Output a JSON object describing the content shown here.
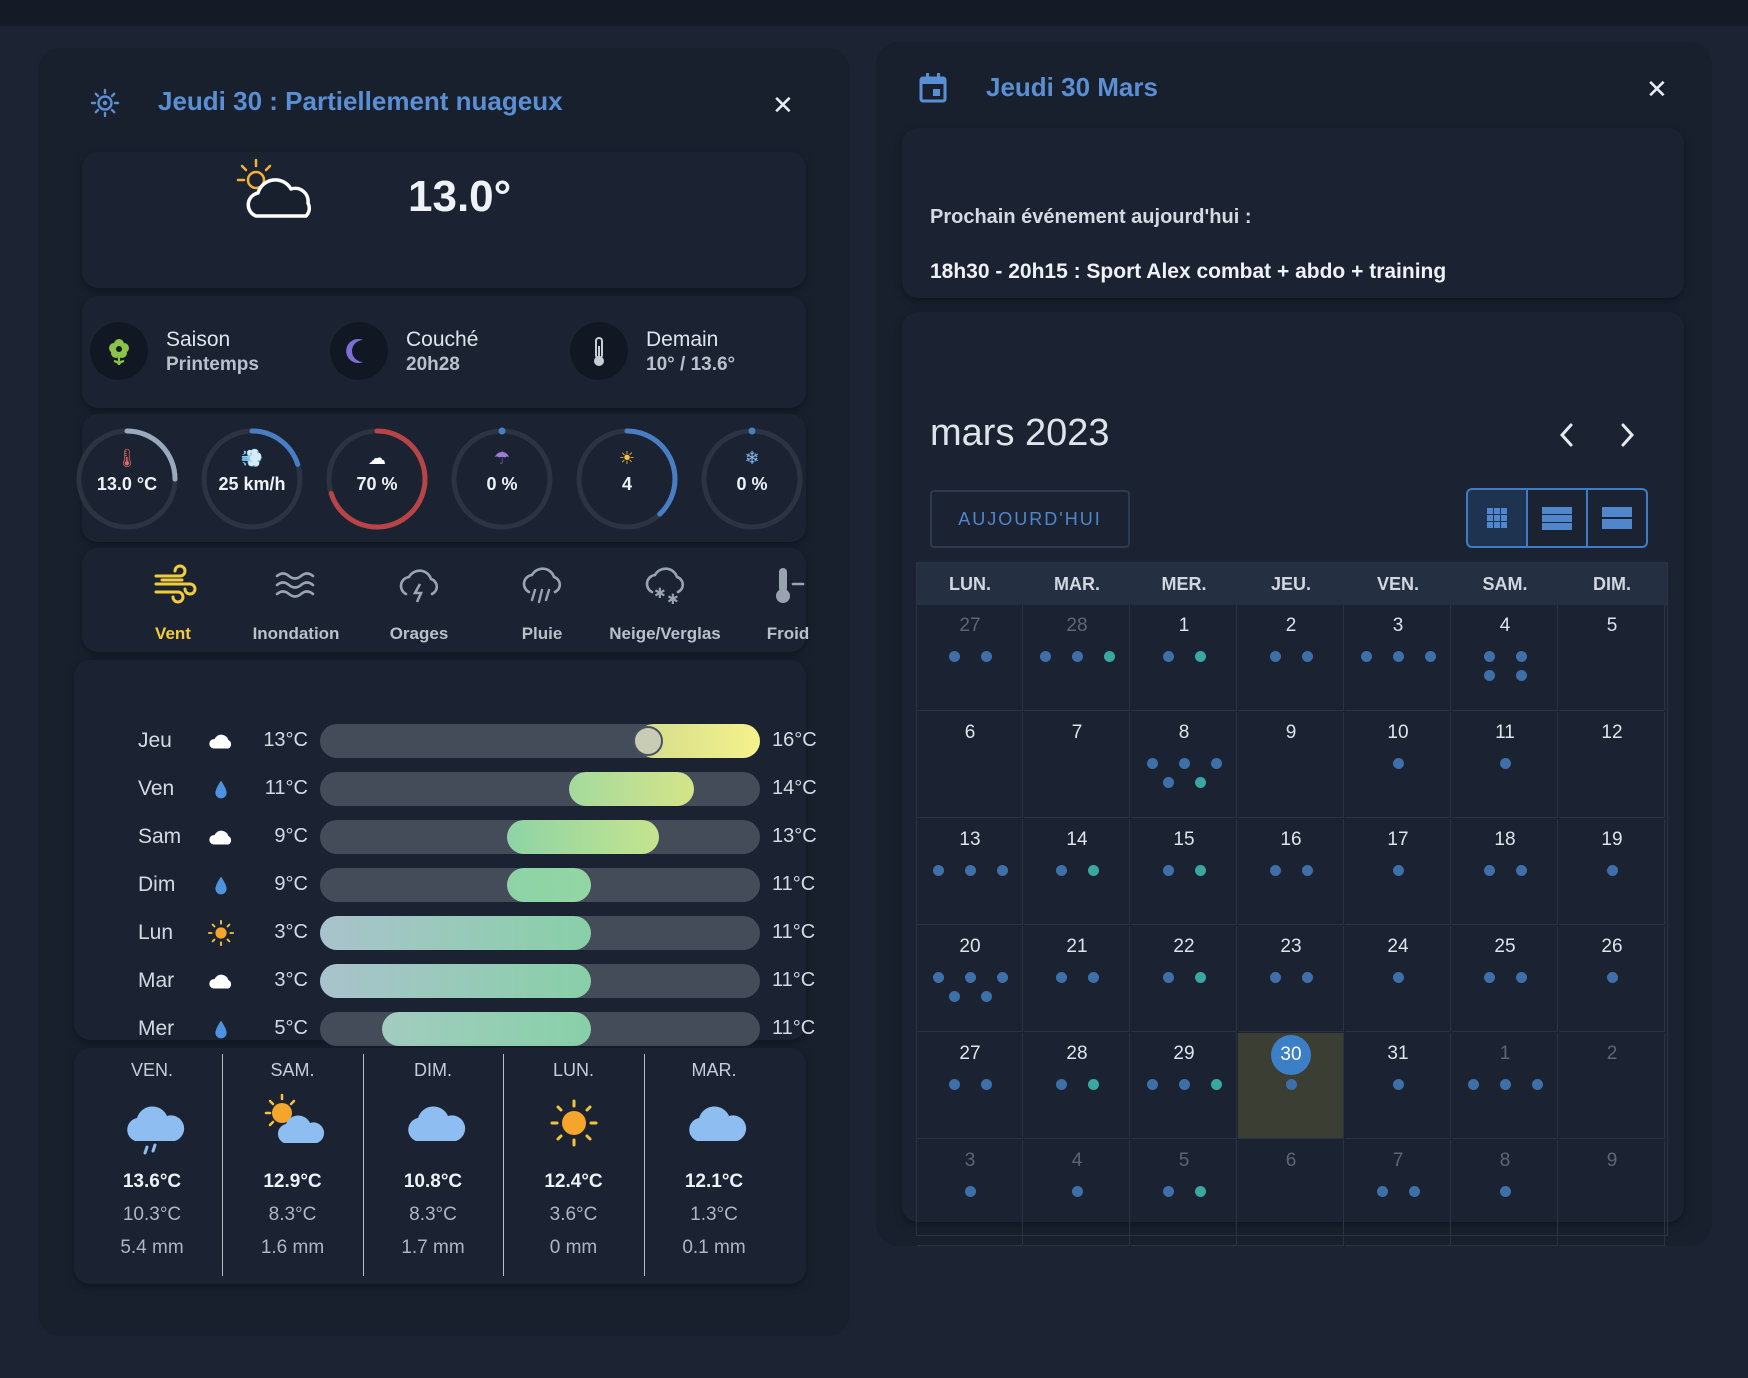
{
  "weather": {
    "header_title": "Jeudi 30 : Partiellement nuageux",
    "current_temp": "13.0°",
    "info": [
      {
        "icon": "flower-icon",
        "label": "Saison",
        "value": "Printemps"
      },
      {
        "icon": "moon-icon",
        "label": "Couché",
        "value": "20h28"
      },
      {
        "icon": "thermometer-icon",
        "label": "Demain",
        "value": "10° / 13.6°"
      }
    ],
    "gauges": [
      {
        "icon": "thermometer-icon",
        "value": "13.0 °C",
        "fraction": 0.25,
        "color": "#9aa9bd"
      },
      {
        "icon": "wind-icon",
        "value": "25 km/h",
        "fraction": 0.2,
        "color": "#4a7ec4"
      },
      {
        "icon": "cloud-icon",
        "value": "70 %",
        "fraction": 0.7,
        "color": "#b84447"
      },
      {
        "icon": "umbrella-icon",
        "value": "0 %",
        "fraction": 0.0,
        "color": "#4a7ec4"
      },
      {
        "icon": "sun-icon",
        "value": "4",
        "fraction": 0.38,
        "color": "#4a7ec4"
      },
      {
        "icon": "snowflake-icon",
        "value": "0 %",
        "fraction": 0.0,
        "color": "#4a7ec4"
      }
    ],
    "alerts": [
      {
        "icon": "wind-alert-icon",
        "label": "Vent",
        "active": true
      },
      {
        "icon": "flood-icon",
        "label": "Inondation",
        "active": false
      },
      {
        "icon": "storm-icon",
        "label": "Orages",
        "active": false
      },
      {
        "icon": "rain-icon",
        "label": "Pluie",
        "active": false
      },
      {
        "icon": "snow-ice-icon",
        "label": "Neige/Verglas",
        "active": false
      },
      {
        "icon": "cold-icon",
        "label": "Froid",
        "active": false
      }
    ],
    "forecast": [
      {
        "day": "Jeu",
        "icon": "cloud-icon",
        "min": "13°C",
        "max": "16°C",
        "start": 0.72,
        "end": 1.0,
        "marker": 0.745,
        "gradient": "#d3dc8c,#f4f28c"
      },
      {
        "day": "Ven",
        "icon": "drop-icon",
        "min": "11°C",
        "max": "14°C",
        "start": 0.565,
        "end": 0.85,
        "gradient": "#a4da9e,#d4e488"
      },
      {
        "day": "Sam",
        "icon": "cloud-icon",
        "min": "9°C",
        "max": "13°C",
        "start": 0.425,
        "end": 0.77,
        "gradient": "#8ed3a6,#c5e48e"
      },
      {
        "day": "Dim",
        "icon": "drop-icon",
        "min": "9°C",
        "max": "11°C",
        "start": 0.425,
        "end": 0.615,
        "gradient": "#8ed3a6,#92d6a4"
      },
      {
        "day": "Lun",
        "icon": "sun-icon",
        "min": "3°C",
        "max": "11°C",
        "start": 0.0,
        "end": 0.615,
        "gradient": "#a9c3cc,#88d0a8"
      },
      {
        "day": "Mar",
        "icon": "cloud-icon",
        "min": "3°C",
        "max": "11°C",
        "start": 0.0,
        "end": 0.615,
        "gradient": "#a9c3cc,#88d0a8"
      },
      {
        "day": "Mer",
        "icon": "drop-icon",
        "min": "5°C",
        "max": "11°C",
        "start": 0.14,
        "end": 0.615,
        "gradient": "#a2ccc0,#88d0a8"
      }
    ],
    "daily": [
      {
        "name": "VEN.",
        "icon": "rain-cloud-icon",
        "hi": "13.6°C",
        "lo": "10.3°C",
        "mm": "5.4 mm"
      },
      {
        "name": "SAM.",
        "icon": "sun-cloud-icon",
        "hi": "12.9°C",
        "lo": "8.3°C",
        "mm": "1.6 mm"
      },
      {
        "name": "DIM.",
        "icon": "cloud-icon",
        "hi": "10.8°C",
        "lo": "8.3°C",
        "mm": "1.7 mm"
      },
      {
        "name": "LUN.",
        "icon": "sun-icon",
        "hi": "12.4°C",
        "lo": "3.6°C",
        "mm": "0 mm"
      },
      {
        "name": "MAR.",
        "icon": "cloud-icon",
        "hi": "12.1°C",
        "lo": "1.3°C",
        "mm": "0.1 mm"
      }
    ]
  },
  "calendar": {
    "header_title": "Jeudi 30 Mars",
    "next_event_label": "Prochain événement aujourd'hui :",
    "next_event": "18h30 - 20h15 : Sport Alex combat + abdo + training",
    "month_title": "mars 2023",
    "today_button": "AUJOURD'HUI",
    "weekdays": [
      "LUN.",
      "MAR.",
      "MER.",
      "JEU.",
      "VEN.",
      "SAM.",
      "DIM."
    ],
    "colors": {
      "dot": "#3f6fa8",
      "dot_teal": "#3aa8a0",
      "today_bg": "#3a3e33",
      "today_circle": "#3d7fc6"
    },
    "days": [
      {
        "d": "27",
        "o": true,
        "dots": "bb"
      },
      {
        "d": "28",
        "o": true,
        "dots": "bbt"
      },
      {
        "d": "1",
        "dots": "bt"
      },
      {
        "d": "2",
        "dots": "bb"
      },
      {
        "d": "3",
        "dots": "bbb"
      },
      {
        "d": "4",
        "dots": "bbbb"
      },
      {
        "d": "5",
        "dots": ""
      },
      {
        "d": "6",
        "dots": ""
      },
      {
        "d": "7",
        "dots": ""
      },
      {
        "d": "8",
        "dots": "bbbbt"
      },
      {
        "d": "9",
        "dots": ""
      },
      {
        "d": "10",
        "dots": "b"
      },
      {
        "d": "11",
        "dots": "b"
      },
      {
        "d": "12",
        "dots": ""
      },
      {
        "d": "13",
        "dots": "bbb"
      },
      {
        "d": "14",
        "dots": "bt"
      },
      {
        "d": "15",
        "dots": "bt"
      },
      {
        "d": "16",
        "dots": "bb"
      },
      {
        "d": "17",
        "dots": "b"
      },
      {
        "d": "18",
        "dots": "bb"
      },
      {
        "d": "19",
        "dots": "b"
      },
      {
        "d": "20",
        "dots": "bbbbb"
      },
      {
        "d": "21",
        "dots": "bb"
      },
      {
        "d": "22",
        "dots": "bt"
      },
      {
        "d": "23",
        "dots": "bb"
      },
      {
        "d": "24",
        "dots": "b"
      },
      {
        "d": "25",
        "dots": "bb"
      },
      {
        "d": "26",
        "dots": "b"
      },
      {
        "d": "27",
        "dots": "bb"
      },
      {
        "d": "28",
        "dots": "bt"
      },
      {
        "d": "29",
        "dots": "bbt"
      },
      {
        "d": "30",
        "dots": "b",
        "today": true
      },
      {
        "d": "31",
        "dots": "b"
      },
      {
        "d": "1",
        "o": true,
        "dots": "bbb"
      },
      {
        "d": "2",
        "o": true,
        "dots": ""
      },
      {
        "d": "3",
        "o": true,
        "dots": "b"
      },
      {
        "d": "4",
        "o": true,
        "dots": "b"
      },
      {
        "d": "5",
        "o": true,
        "dots": "bt"
      },
      {
        "d": "6",
        "o": true,
        "dots": ""
      },
      {
        "d": "7",
        "o": true,
        "dots": "bb"
      },
      {
        "d": "8",
        "o": true,
        "dots": "b"
      },
      {
        "d": "9",
        "o": true,
        "dots": ""
      }
    ]
  }
}
